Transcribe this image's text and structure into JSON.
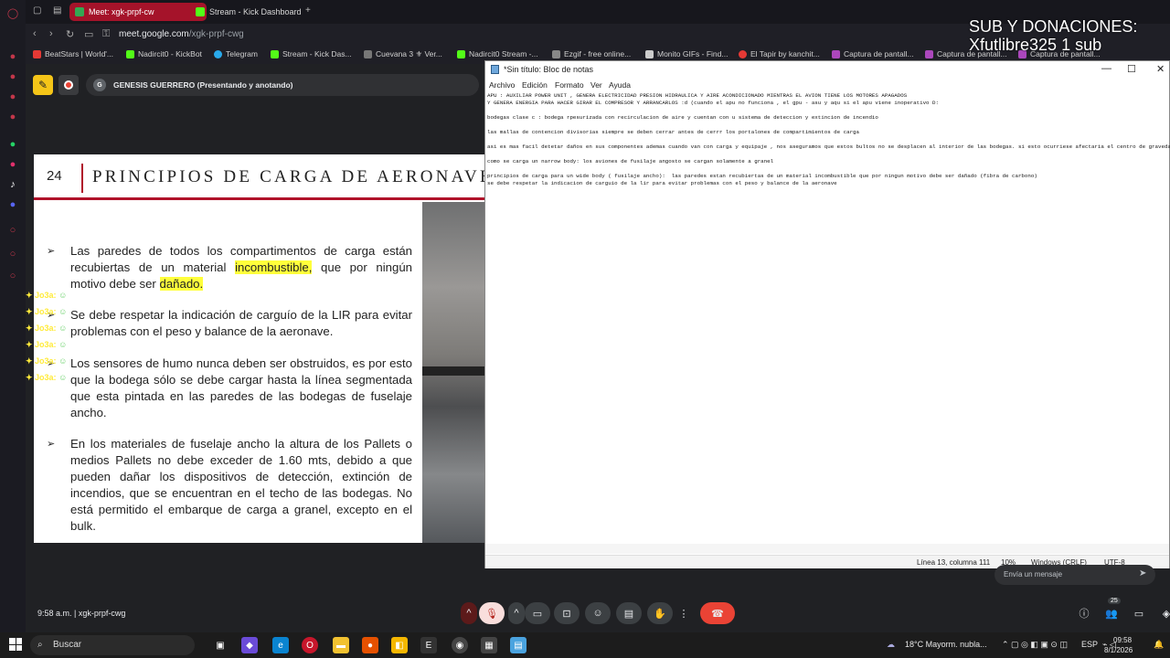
{
  "browser": {
    "tabs": [
      {
        "label": "Meet: xgk-prpf-cw"
      },
      {
        "label": "Stream - Kick Dashboard"
      }
    ],
    "url_host": "meet.google.com",
    "url_path": "/xgk-prpf-cwg",
    "bookmarks": [
      "BeatStars | World'...",
      "Nadircit0 - KickBot",
      "Telegram",
      "Stream - Kick Das...",
      "Cuevana 3 ⚜ Ver...",
      "Nadircit0 Stream -...",
      "Ezgif - free online...",
      "Monito GIFs - Find...",
      "El Tapir by kanchit...",
      "Captura de pantall...",
      "Captura de pantall...",
      "Captura de pantall..."
    ]
  },
  "meet": {
    "presenter": "GENESIS GUERRERO (Presentando y anotando)",
    "presenter_initial": "G",
    "time": "9:58 a.m.",
    "meeting_code": "xgk-prpf-cwg",
    "chat_placeholder": "Envía un mensaje",
    "participants": "25"
  },
  "slide": {
    "number": "24",
    "title": "PRINCIPIOS DE CARGA DE AERONAVES",
    "b1_pre": "Las paredes de todos los compartimentos de carga están recubiertas de un material ",
    "b1_hl1": "incombustible,",
    "b1_mid": " que por ningún motivo debe ser ",
    "b1_hl2": "dañado.",
    "b2": "Se debe  respetar la indicación de carguío de la LIR para evitar problemas con el peso y balance de la aeronave.",
    "b3": "Los sensores de humo nunca deben ser obstruidos, es por esto que la bodega sólo se debe cargar hasta la línea segmentada que esta pintada en las paredes de las bodegas de fuselaje ancho.",
    "b4": "En los materiales de fuselaje ancho la altura de los Pallets o medios Pallets no debe exceder de 1.60 mts, debido a que pueden dañar los dispositivos de detección, extinción de incendios, que se encuentran en el techo de las bodegas. No está permitido el embarque de carga a granel, excepto en el bulk.",
    "arrow": "➢"
  },
  "chat_overlay": {
    "name": "Jo3a:"
  },
  "overlay": {
    "line1": "SUB Y DONACIONES:",
    "line2": "Xfutlibre325 1 sub"
  },
  "notepad": {
    "title": "*Sin título: Bloc de notas",
    "menu": [
      "Archivo",
      "Edición",
      "Formato",
      "Ver",
      "Ayuda"
    ],
    "text": "APU : AUXILIAR POWER UNIT , GENERA ELECTRICIDAD PRESION HIDRAULICA Y AIRE ACONDICIONADO MIENTRAS EL AVION TIENE LOS MOTORES APAGADOS\nY GENERA ENERGIA PARA HACER GIRAR EL COMPRESOR Y ARRANCARLOS :d (cuando el apu no funciona , el gpu - asu y aqu si el apu viene inoperativo D:\n\nbodegas clase c : bodega rpesurizada con recirculacion de aire y cuentan con u sistema de deteccion y extincion de incendio\n\nlas mallas de contencion divisorias siempre se deben cerrar antes de cerrr los portalones de compartimientos de carga\n\nasi es mas facil detetar daños en sus componentes ademas cuando van con carga y equipaje , nos aseguramos que estos bultos no se desplacen al interior de las bodegas. si esto ocurriese afectaria el centro de gravedad D:\n\ncomo se carga un narrow body: los aviones de fusilaje angosto se cargan solamente a granel\n\nprincipios de carga para un wide body ( fusilaje ancho):  las paredes estan recubiertas de un material incombustible que por ningun motivo debe ser dañado (fibra de carbono)\nse debe respetar la indicacion de carguio de la lir para evitar problemas con el peso y balance de la aeronave",
    "status_pos": "Línea 13, columna 111",
    "status_zoom": "10%",
    "status_eol": "Windows (CRLF)",
    "status_enc": "UTF-8"
  },
  "taskbar": {
    "search": "Buscar",
    "weather": "18°C  Mayorm. nubla...",
    "lang": "ESP",
    "clock_time": "09:58",
    "clock_date": "8/1/2026"
  }
}
